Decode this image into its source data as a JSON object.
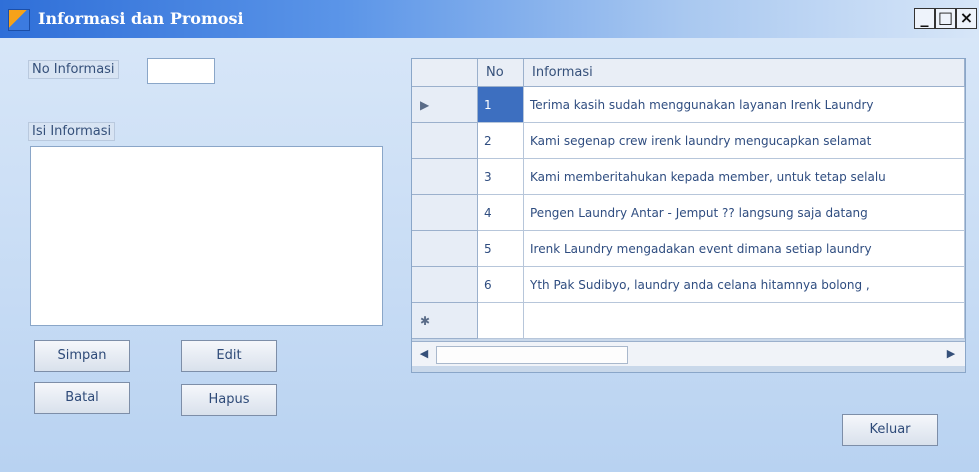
{
  "window": {
    "title": "Informasi dan Promosi",
    "controls": {
      "minimize": "_",
      "maximize": "□",
      "close": "×"
    }
  },
  "form": {
    "no_informasi_label": "No Informasi",
    "no_informasi_value": "",
    "isi_informasi_label": "Isi Informasi",
    "isi_informasi_value": "",
    "buttons": {
      "simpan": "Simpan",
      "edit": "Edit",
      "batal": "Batal",
      "hapus": "Hapus",
      "keluar": "Keluar"
    }
  },
  "grid": {
    "columns": [
      "No",
      "Informasi"
    ],
    "current_row_marker": "▶",
    "new_row_marker": "✱",
    "rows": [
      {
        "no": "1",
        "informasi": "Terima kasih sudah menggunakan layanan Irenk Laundry"
      },
      {
        "no": "2",
        "informasi": "Kami segenap crew irenk laundry mengucapkan selamat"
      },
      {
        "no": "3",
        "informasi": "Kami memberitahukan kepada member, untuk tetap selalu"
      },
      {
        "no": "4",
        "informasi": "Pengen Laundry Antar - Jemput ?? langsung saja datang"
      },
      {
        "no": "5",
        "informasi": "Irenk Laundry mengadakan event dimana setiap laundry"
      },
      {
        "no": "6",
        "informasi": "Yth Pak Sudibyo, laundry anda celana hitamnya bolong ,"
      }
    ],
    "scroll_left": "◀",
    "scroll_right": "▶"
  }
}
